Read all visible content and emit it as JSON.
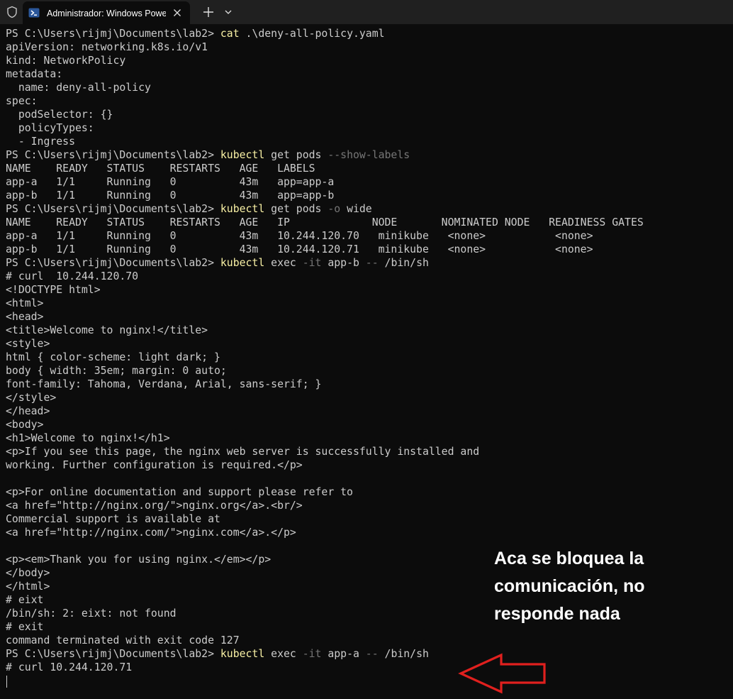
{
  "window": {
    "tab_title": "Administrador: Windows PowerShell",
    "new_tab_symbol": "+",
    "icons": [
      "shield-icon",
      "powershell-icon",
      "close-icon",
      "plus-icon",
      "chevron-down-icon"
    ]
  },
  "colors": {
    "background": "#0c0c0c",
    "titlebar": "#202020",
    "text": "#cccccc",
    "command": "#f9f1a5",
    "parameter": "#767676",
    "annotation_text": "#ffffff",
    "arrow": "#e0201e"
  },
  "terminal": {
    "lines": [
      [
        {
          "t": "PS C:\\Users\\rijmj\\Documents\\lab2> "
        },
        {
          "t": "cat",
          "s": "cmd"
        },
        {
          "t": " .\\deny-all-policy.yaml"
        }
      ],
      [
        {
          "t": "apiVersion: networking.k8s.io/v1"
        }
      ],
      [
        {
          "t": "kind: NetworkPolicy"
        }
      ],
      [
        {
          "t": "metadata:"
        }
      ],
      [
        {
          "t": "  name: deny-all-policy"
        }
      ],
      [
        {
          "t": "spec:"
        }
      ],
      [
        {
          "t": "  podSelector: {}"
        }
      ],
      [
        {
          "t": "  policyTypes:"
        }
      ],
      [
        {
          "t": "  - Ingress"
        }
      ],
      [
        {
          "t": "PS C:\\Users\\rijmj\\Documents\\lab2> "
        },
        {
          "t": "kubectl",
          "s": "cmd"
        },
        {
          "t": " get pods "
        },
        {
          "t": "--show-labels",
          "s": "dim"
        }
      ],
      [
        {
          "t": "NAME    READY   STATUS    RESTARTS   AGE   LABELS"
        }
      ],
      [
        {
          "t": "app-a   1/1     Running   0          43m   app=app-a"
        }
      ],
      [
        {
          "t": "app-b   1/1     Running   0          43m   app=app-b"
        }
      ],
      [
        {
          "t": "PS C:\\Users\\rijmj\\Documents\\lab2> "
        },
        {
          "t": "kubectl",
          "s": "cmd"
        },
        {
          "t": " get pods "
        },
        {
          "t": "-o",
          "s": "dim"
        },
        {
          "t": " wide"
        }
      ],
      [
        {
          "t": "NAME    READY   STATUS    RESTARTS   AGE   IP             NODE       NOMINATED NODE   READINESS GATES"
        }
      ],
      [
        {
          "t": "app-a   1/1     Running   0          43m   10.244.120.70   minikube   <none>           <none>"
        }
      ],
      [
        {
          "t": "app-b   1/1     Running   0          43m   10.244.120.71   minikube   <none>           <none>"
        }
      ],
      [
        {
          "t": "PS C:\\Users\\rijmj\\Documents\\lab2> "
        },
        {
          "t": "kubectl",
          "s": "cmd"
        },
        {
          "t": " exec "
        },
        {
          "t": "-it",
          "s": "dim"
        },
        {
          "t": " app-b "
        },
        {
          "t": "--",
          "s": "dim"
        },
        {
          "t": " /bin/sh"
        }
      ],
      [
        {
          "t": "# curl  10.244.120.70"
        }
      ],
      [
        {
          "t": "<!DOCTYPE html>"
        }
      ],
      [
        {
          "t": "<html>"
        }
      ],
      [
        {
          "t": "<head>"
        }
      ],
      [
        {
          "t": "<title>Welcome to nginx!</title>"
        }
      ],
      [
        {
          "t": "<style>"
        }
      ],
      [
        {
          "t": "html { color-scheme: light dark; }"
        }
      ],
      [
        {
          "t": "body { width: 35em; margin: 0 auto;"
        }
      ],
      [
        {
          "t": "font-family: Tahoma, Verdana, Arial, sans-serif; }"
        }
      ],
      [
        {
          "t": "</style>"
        }
      ],
      [
        {
          "t": "</head>"
        }
      ],
      [
        {
          "t": "<body>"
        }
      ],
      [
        {
          "t": "<h1>Welcome to nginx!</h1>"
        }
      ],
      [
        {
          "t": "<p>If you see this page, the nginx web server is successfully installed and"
        }
      ],
      [
        {
          "t": "working. Further configuration is required.</p>"
        }
      ],
      [
        {
          "t": ""
        }
      ],
      [
        {
          "t": "<p>For online documentation and support please refer to"
        }
      ],
      [
        {
          "t": "<a href=\"http://nginx.org/\">nginx.org</a>.<br/>"
        }
      ],
      [
        {
          "t": "Commercial support is available at"
        }
      ],
      [
        {
          "t": "<a href=\"http://nginx.com/\">nginx.com</a>.</p>"
        }
      ],
      [
        {
          "t": ""
        }
      ],
      [
        {
          "t": "<p><em>Thank you for using nginx.</em></p>"
        }
      ],
      [
        {
          "t": "</body>"
        }
      ],
      [
        {
          "t": "</html>"
        }
      ],
      [
        {
          "t": "# eixt"
        }
      ],
      [
        {
          "t": "/bin/sh: 2: eixt: not found"
        }
      ],
      [
        {
          "t": "# exit"
        }
      ],
      [
        {
          "t": "command terminated with exit code 127"
        }
      ],
      [
        {
          "t": "PS C:\\Users\\rijmj\\Documents\\lab2> "
        },
        {
          "t": "kubectl",
          "s": "cmd"
        },
        {
          "t": " exec "
        },
        {
          "t": "-it",
          "s": "dim"
        },
        {
          "t": " app-a "
        },
        {
          "t": "--",
          "s": "dim"
        },
        {
          "t": " /bin/sh"
        }
      ],
      [
        {
          "t": "# curl 10.244.120.71"
        }
      ]
    ]
  },
  "annotation": {
    "text": "Aca se bloquea la\ncomunicación, no\nresponde nada"
  }
}
